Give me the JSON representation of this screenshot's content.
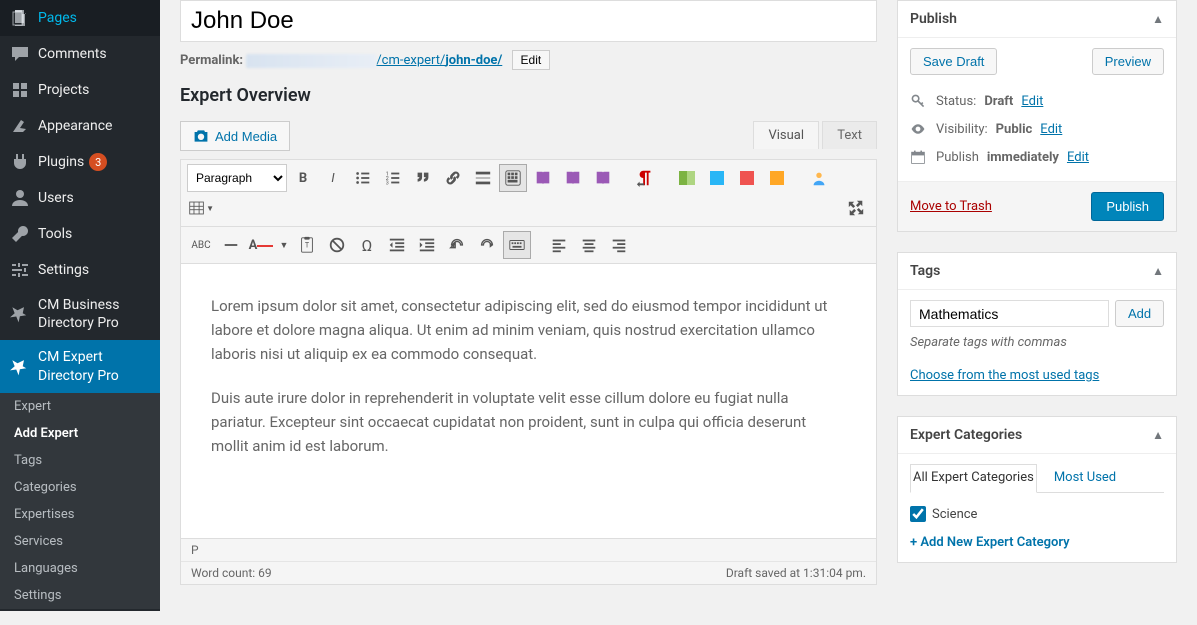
{
  "sidebar": {
    "items": [
      {
        "key": "pages",
        "label": "Pages"
      },
      {
        "key": "comments",
        "label": "Comments"
      },
      {
        "key": "projects",
        "label": "Projects"
      },
      {
        "key": "appearance",
        "label": "Appearance"
      },
      {
        "key": "plugins",
        "label": "Plugins",
        "badge": "3"
      },
      {
        "key": "users",
        "label": "Users"
      },
      {
        "key": "tools",
        "label": "Tools"
      },
      {
        "key": "settings",
        "label": "Settings"
      },
      {
        "key": "cm-biz",
        "label": "CM Business Directory Pro"
      },
      {
        "key": "cm-expert",
        "label": "CM Expert Directory Pro"
      }
    ],
    "submenu": [
      {
        "label": "Expert"
      },
      {
        "label": "Add Expert",
        "active": true
      },
      {
        "label": "Tags"
      },
      {
        "label": "Categories"
      },
      {
        "label": "Expertises"
      },
      {
        "label": "Services"
      },
      {
        "label": "Languages"
      },
      {
        "label": "Settings"
      }
    ]
  },
  "editor": {
    "title_value": "John Doe",
    "permalink_label": "Permalink:",
    "permalink_path_prefix": "/cm-expert/",
    "permalink_slug": "john-doe/",
    "permalink_edit": "Edit",
    "section_heading": "Expert Overview",
    "add_media": "Add Media",
    "tabs": {
      "visual": "Visual",
      "text": "Text",
      "active": "visual"
    },
    "format_select": "Paragraph",
    "body_p1": "Lorem ipsum dolor sit amet, consectetur adipiscing elit, sed do eiusmod tempor incididunt ut labore et dolore magna aliqua. Ut enim ad minim veniam, quis nostrud exercitation ullamco laboris nisi ut aliquip ex ea commodo consequat.",
    "body_p2": "Duis aute irure dolor in reprehenderit in voluptate velit esse cillum dolore eu fugiat nulla pariatur. Excepteur sint occaecat cupidatat non proident, sunt in culpa qui officia deserunt mollit anim id est laborum.",
    "footer_path": "P",
    "word_count_label": "Word count: 69",
    "draft_saved": "Draft saved at 1:31:04 pm."
  },
  "publish": {
    "title": "Publish",
    "save_draft": "Save Draft",
    "preview": "Preview",
    "status_label": "Status:",
    "status_value": "Draft",
    "visibility_label": "Visibility:",
    "visibility_value": "Public",
    "schedule_label": "Publish",
    "schedule_value": "immediately",
    "edit": "Edit",
    "trash": "Move to Trash",
    "publish_btn": "Publish"
  },
  "tags": {
    "title": "Tags",
    "input_value": "Mathematics",
    "add": "Add",
    "hint": "Separate tags with commas",
    "choose": "Choose from the most used tags"
  },
  "categories": {
    "title": "Expert Categories",
    "tab_all": "All Expert Categories",
    "tab_most": "Most Used",
    "items": [
      {
        "label": "Science",
        "checked": true
      }
    ],
    "add_new": "+ Add New Expert Category"
  }
}
